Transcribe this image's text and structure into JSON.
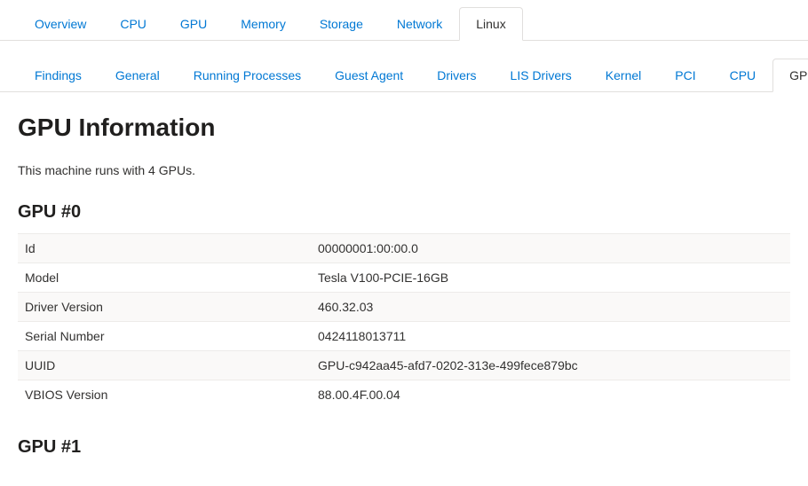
{
  "primaryTabs": {
    "items": [
      {
        "label": "Overview"
      },
      {
        "label": "CPU"
      },
      {
        "label": "GPU"
      },
      {
        "label": "Memory"
      },
      {
        "label": "Storage"
      },
      {
        "label": "Network"
      },
      {
        "label": "Linux"
      }
    ],
    "activeIndex": 6
  },
  "secondaryTabs": {
    "items": [
      {
        "label": "Findings"
      },
      {
        "label": "General"
      },
      {
        "label": "Running Processes"
      },
      {
        "label": "Guest Agent"
      },
      {
        "label": "Drivers"
      },
      {
        "label": "LIS Drivers"
      },
      {
        "label": "Kernel"
      },
      {
        "label": "PCI"
      },
      {
        "label": "CPU"
      },
      {
        "label": "GPU"
      }
    ],
    "activeIndex": 9
  },
  "page": {
    "title": "GPU Information",
    "description": "This machine runs with 4 GPUs."
  },
  "gpus": [
    {
      "heading": "GPU #0",
      "rows": [
        {
          "key": "Id",
          "value": "00000001:00:00.0"
        },
        {
          "key": "Model",
          "value": "Tesla V100-PCIE-16GB"
        },
        {
          "key": "Driver Version",
          "value": "460.32.03"
        },
        {
          "key": "Serial Number",
          "value": "0424118013711"
        },
        {
          "key": "UUID",
          "value": "GPU-c942aa45-afd7-0202-313e-499fece879bc"
        },
        {
          "key": "VBIOS Version",
          "value": "88.00.4F.00.04"
        }
      ]
    },
    {
      "heading": "GPU #1",
      "rows": []
    }
  ]
}
